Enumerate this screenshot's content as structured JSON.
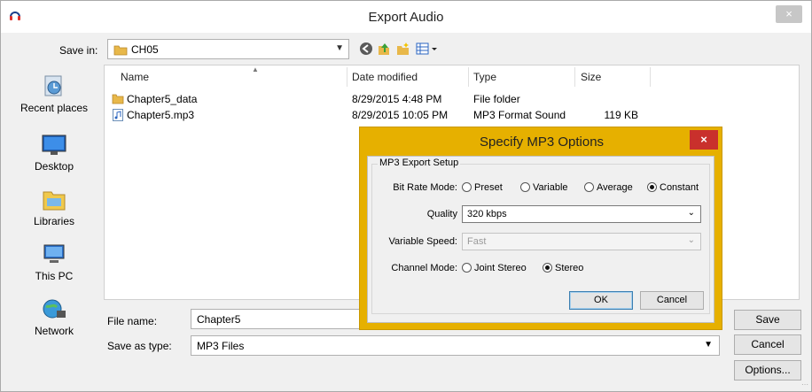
{
  "window": {
    "title": "Export Audio",
    "close_glyph": "×"
  },
  "save_in": {
    "label": "Save in:",
    "value": "CH05"
  },
  "places": [
    {
      "label": "Recent places",
      "icon": "recent-places-icon"
    },
    {
      "label": "Desktop",
      "icon": "desktop-icon"
    },
    {
      "label": "Libraries",
      "icon": "libraries-icon"
    },
    {
      "label": "This PC",
      "icon": "this-pc-icon"
    },
    {
      "label": "Network",
      "icon": "network-icon"
    }
  ],
  "columns": {
    "name": "Name",
    "date": "Date modified",
    "type": "Type",
    "size": "Size"
  },
  "files": [
    {
      "name": "Chapter5_data",
      "date": "8/29/2015 4:48 PM",
      "type": "File folder",
      "size": ""
    },
    {
      "name": "Chapter5.mp3",
      "date": "8/29/2015 10:05 PM",
      "type": "MP3 Format Sound",
      "size": "119 KB"
    }
  ],
  "file_name": {
    "label": "File name:",
    "value": "Chapter5"
  },
  "save_as_type": {
    "label": "Save as type:",
    "value": "MP3 Files"
  },
  "buttons": {
    "save": "Save",
    "cancel": "Cancel",
    "options": "Options..."
  },
  "mp3_dialog": {
    "title": "Specify MP3 Options",
    "close_glyph": "×",
    "group": "MP3 Export Setup",
    "bit_rate_label": "Bit Rate Mode:",
    "bit_rate_options": [
      "Preset",
      "Variable",
      "Average",
      "Constant"
    ],
    "bit_rate_selected": "Constant",
    "quality_label": "Quality",
    "quality_value": "320 kbps",
    "variable_speed_label": "Variable Speed:",
    "variable_speed_value": "Fast",
    "channel_label": "Channel Mode:",
    "channel_options": [
      "Joint Stereo",
      "Stereo"
    ],
    "channel_selected": "Stereo",
    "ok": "OK",
    "cancel": "Cancel"
  },
  "colors": {
    "accent_dialog_border": "#e6b000",
    "close_red": "#c9302c",
    "folder_yellow": "#e8b84a"
  }
}
